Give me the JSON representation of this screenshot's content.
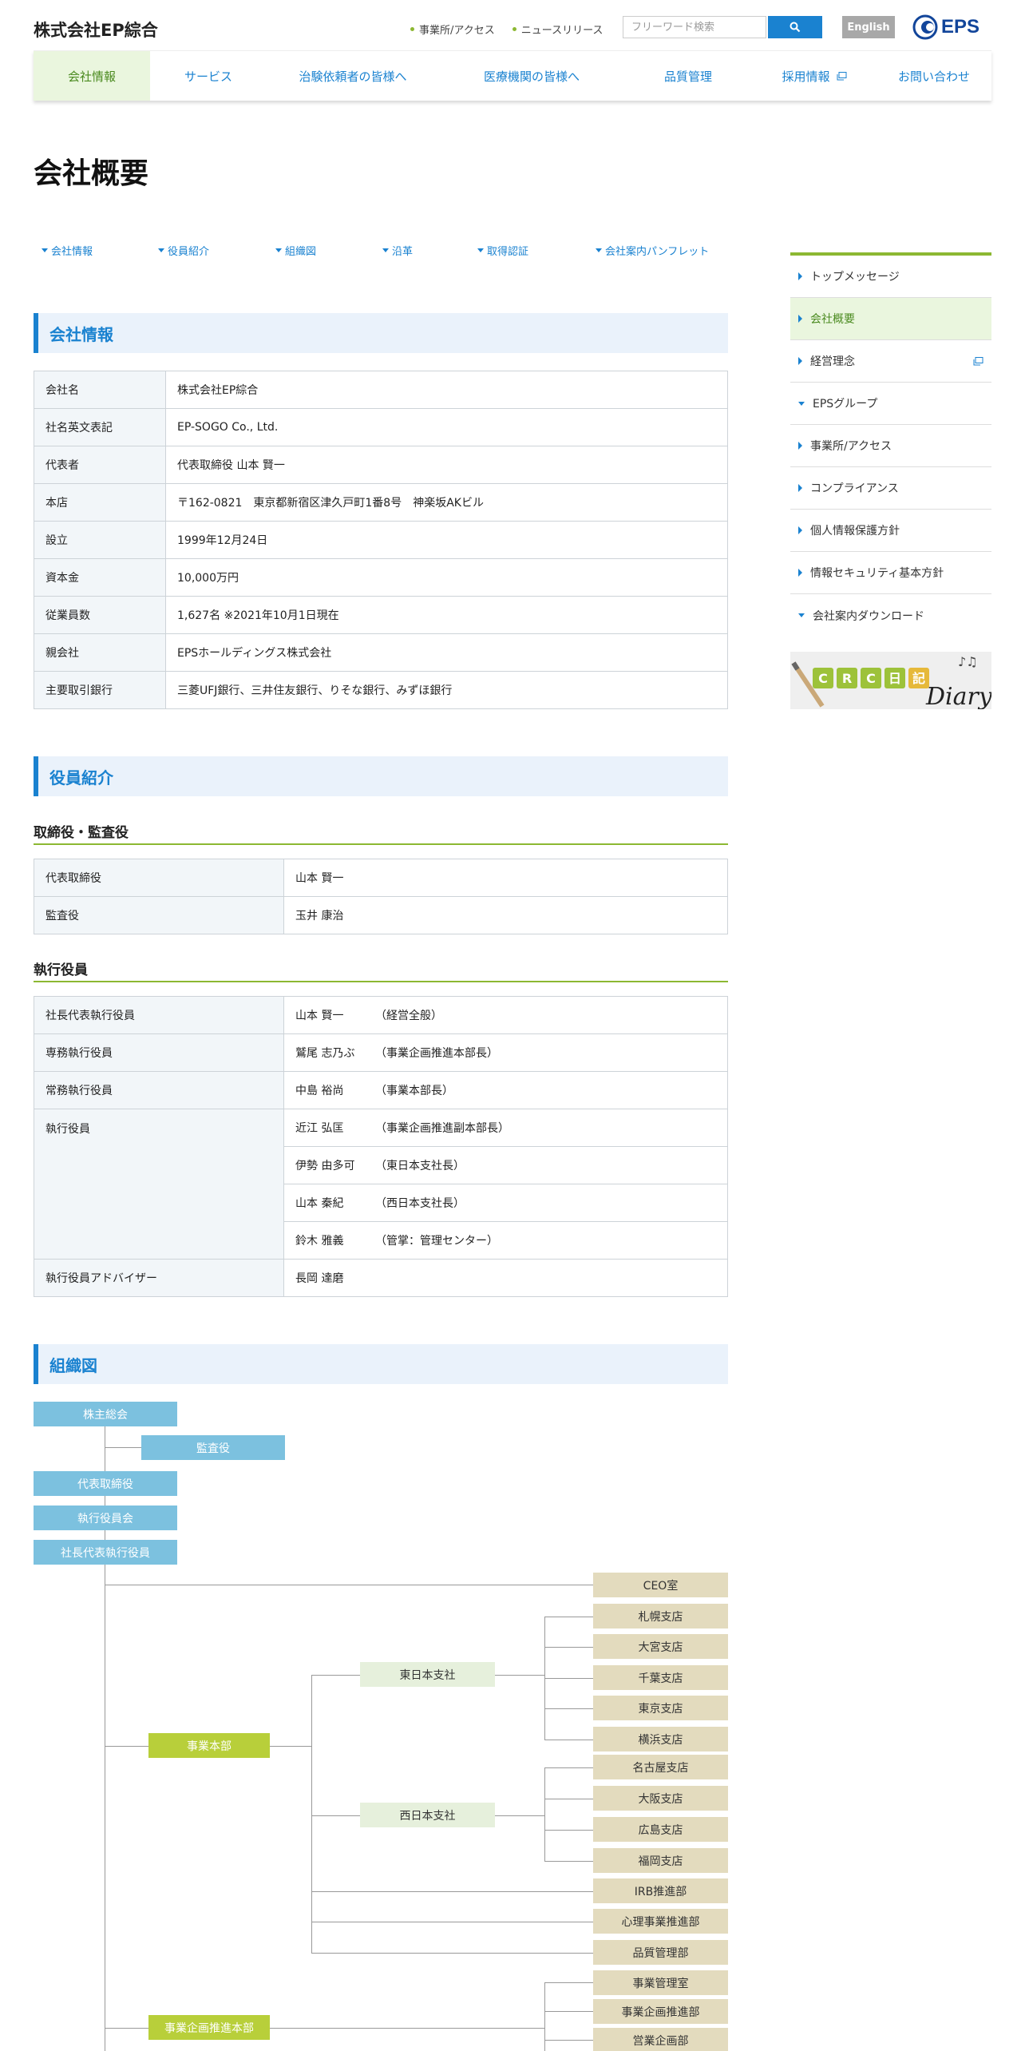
{
  "header": {
    "company_name": "株式会社EP綜合",
    "util_links": [
      "事業所/アクセス",
      "ニュースリリース"
    ],
    "search_placeholder": "フリーワード検索",
    "english_label": "English",
    "brand": "EPS"
  },
  "nav": [
    "会社情報",
    "サービス",
    "治験依頼者の皆様へ",
    "医療機関の皆様へ",
    "品質管理",
    "採用情報",
    "お問い合わせ"
  ],
  "page_title": "会社概要",
  "anchors": [
    "会社情報",
    "役員紹介",
    "組織図",
    "沿革",
    "取得認証",
    "会社案内パンフレット"
  ],
  "company_info": {
    "heading": "会社情報",
    "rows": [
      {
        "label": "会社名",
        "value": "株式会社EP綜合"
      },
      {
        "label": "社名英文表記",
        "value": "EP-SOGO Co., Ltd."
      },
      {
        "label": "代表者",
        "value": "代表取締役 山本 賢一"
      },
      {
        "label": "本店",
        "value": "〒162-0821　東京都新宿区津久戸町1番8号　神楽坂AKビル"
      },
      {
        "label": "設立",
        "value": "1999年12月24日"
      },
      {
        "label": "資本金",
        "value": "10,000万円"
      },
      {
        "label": "従業員数",
        "value": "1,627名 ※2021年10月1日現在"
      },
      {
        "label": "親会社",
        "value": "EPSホールディングス株式会社"
      },
      {
        "label": "主要取引銀行",
        "value": "三菱UFJ銀行、三井住友銀行、りそな銀行、みずほ銀行"
      }
    ]
  },
  "officers": {
    "heading": "役員紹介",
    "board_heading": "取締役・監査役",
    "board": [
      {
        "label": "代表取締役",
        "value": "山本 賢一"
      },
      {
        "label": "監査役",
        "value": "玉井 康治"
      }
    ],
    "exec_heading": "執行役員",
    "exec": [
      {
        "label": "社長代表執行役員",
        "name": "山本 賢一",
        "role": "（経営全般）"
      },
      {
        "label": "専務執行役員",
        "name": "鷲尾 志乃ぶ",
        "role": "（事業企画推進本部長）"
      },
      {
        "label": "常務執行役員",
        "name": "中島 裕尚",
        "role": "（事業本部長）"
      },
      {
        "label": "執行役員",
        "name": "近江 弘匡",
        "role": "（事業企画推進副本部長）"
      },
      {
        "label": "",
        "name": "伊勢 由多可",
        "role": "（東日本支社長）"
      },
      {
        "label": "",
        "name": "山本 秦紀",
        "role": "（西日本支社長）"
      },
      {
        "label": "",
        "name": "鈴木 雅義",
        "role": "（管掌：管理センター）"
      },
      {
        "label": "執行役員アドバイザー",
        "name": "長岡 達磨",
        "role": ""
      }
    ]
  },
  "org": {
    "heading": "組織図",
    "top": [
      "株主総会",
      "監査役",
      "代表取締役",
      "執行役員会",
      "社長代表執行役員"
    ],
    "ceo_office": "CEO室",
    "division1": "事業本部",
    "east": "東日本支社",
    "east_branches": [
      "札幌支店",
      "大宮支店",
      "千葉支店",
      "東京支店",
      "横浜支店"
    ],
    "west": "西日本支社",
    "west_branches": [
      "名古屋支店",
      "大阪支店",
      "広島支店",
      "福岡支店"
    ],
    "div1_depts": [
      "IRB推進部",
      "心理事業推進部",
      "品質管理部"
    ],
    "division2": "事業企画推進本部",
    "div2_depts": [
      "事業管理室",
      "事業企画推進部",
      "営業企画部"
    ]
  },
  "sidebar": {
    "items": [
      "トップメッセージ",
      "会社概要",
      "経営理念",
      "EPSグループ",
      "事業所/アクセス",
      "コンプライアンス",
      "個人情報保護方針",
      "情報セキュリティ基本方針",
      "会社案内ダウンロード"
    ],
    "banner_letters": [
      "C",
      "R",
      "C",
      "日",
      "記"
    ],
    "banner_word": "Diary"
  },
  "colors": {
    "accent": "#1a82d0",
    "green": "#8cb832",
    "brand": "#12459a"
  }
}
